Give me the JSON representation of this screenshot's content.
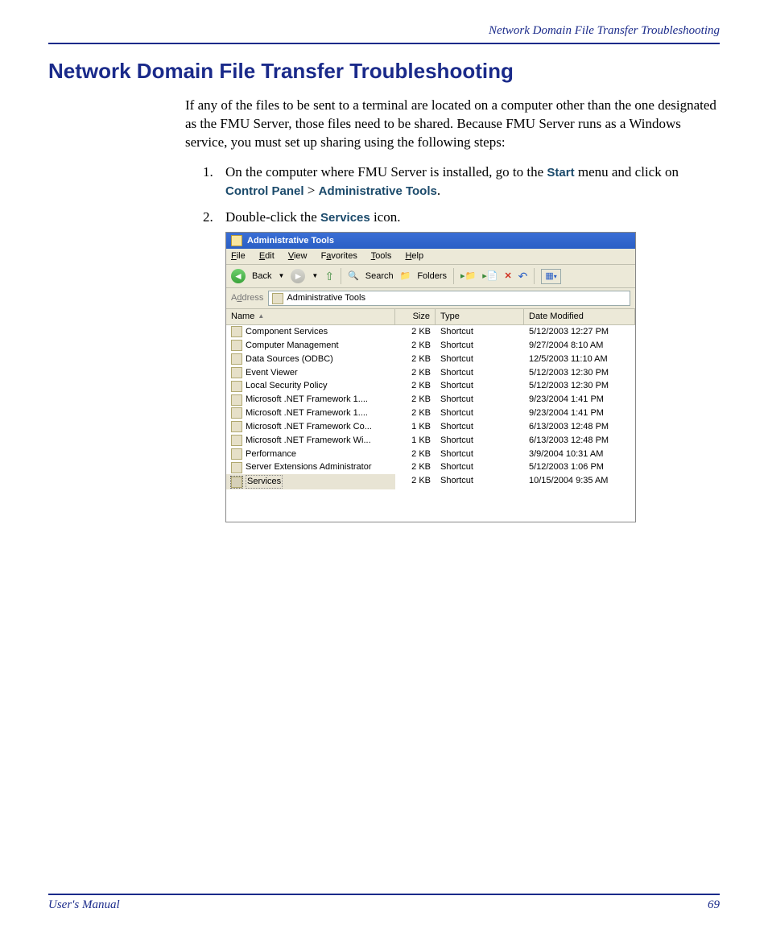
{
  "header": {
    "running_title": "Network Domain File Transfer Troubleshooting"
  },
  "title": "Network Domain File Transfer Troubleshooting",
  "intro": "If any of the files to be sent to a terminal are located on a computer other than the one designated as the FMU Server, those files need to be shared. Because FMU Server runs as a Windows service, you must set up sharing using the following steps:",
  "steps": {
    "s1_a": "On the computer where FMU Server is installed, go to the ",
    "s1_start": "Start",
    "s1_b": " menu and click on ",
    "s1_cp": "Control Panel",
    "s1_gt": " > ",
    "s1_at": "Administrative Tools",
    "s1_end": ".",
    "s2_a": "Double-click the ",
    "s2_srv": "Services",
    "s2_b": " icon."
  },
  "screenshot": {
    "title": "Administrative Tools",
    "menu": {
      "file": "File",
      "edit": "Edit",
      "view": "View",
      "favorites": "Favorites",
      "tools": "Tools",
      "help": "Help"
    },
    "toolbar": {
      "back": "Back",
      "search": "Search",
      "folders": "Folders"
    },
    "address_label": "Address",
    "address_value": "Administrative Tools",
    "columns": {
      "name": "Name",
      "size": "Size",
      "type": "Type",
      "date": "Date Modified"
    },
    "rows": [
      {
        "name": "Component Services",
        "size": "2 KB",
        "type": "Shortcut",
        "date": "5/12/2003 12:27 PM"
      },
      {
        "name": "Computer Management",
        "size": "2 KB",
        "type": "Shortcut",
        "date": "9/27/2004 8:10 AM"
      },
      {
        "name": "Data Sources (ODBC)",
        "size": "2 KB",
        "type": "Shortcut",
        "date": "12/5/2003 11:10 AM"
      },
      {
        "name": "Event Viewer",
        "size": "2 KB",
        "type": "Shortcut",
        "date": "5/12/2003 12:30 PM"
      },
      {
        "name": "Local Security Policy",
        "size": "2 KB",
        "type": "Shortcut",
        "date": "5/12/2003 12:30 PM"
      },
      {
        "name": "Microsoft .NET Framework 1....",
        "size": "2 KB",
        "type": "Shortcut",
        "date": "9/23/2004 1:41 PM"
      },
      {
        "name": "Microsoft .NET Framework 1....",
        "size": "2 KB",
        "type": "Shortcut",
        "date": "9/23/2004 1:41 PM"
      },
      {
        "name": "Microsoft .NET Framework Co...",
        "size": "1 KB",
        "type": "Shortcut",
        "date": "6/13/2003 12:48 PM"
      },
      {
        "name": "Microsoft .NET Framework Wi...",
        "size": "1 KB",
        "type": "Shortcut",
        "date": "6/13/2003 12:48 PM"
      },
      {
        "name": "Performance",
        "size": "2 KB",
        "type": "Shortcut",
        "date": "3/9/2004 10:31 AM"
      },
      {
        "name": "Server Extensions Administrator",
        "size": "2 KB",
        "type": "Shortcut",
        "date": "5/12/2003 1:06 PM"
      },
      {
        "name": "Services",
        "size": "2 KB",
        "type": "Shortcut",
        "date": "10/15/2004 9:35 AM"
      }
    ]
  },
  "footer": {
    "left": "User's Manual",
    "right": "69"
  }
}
